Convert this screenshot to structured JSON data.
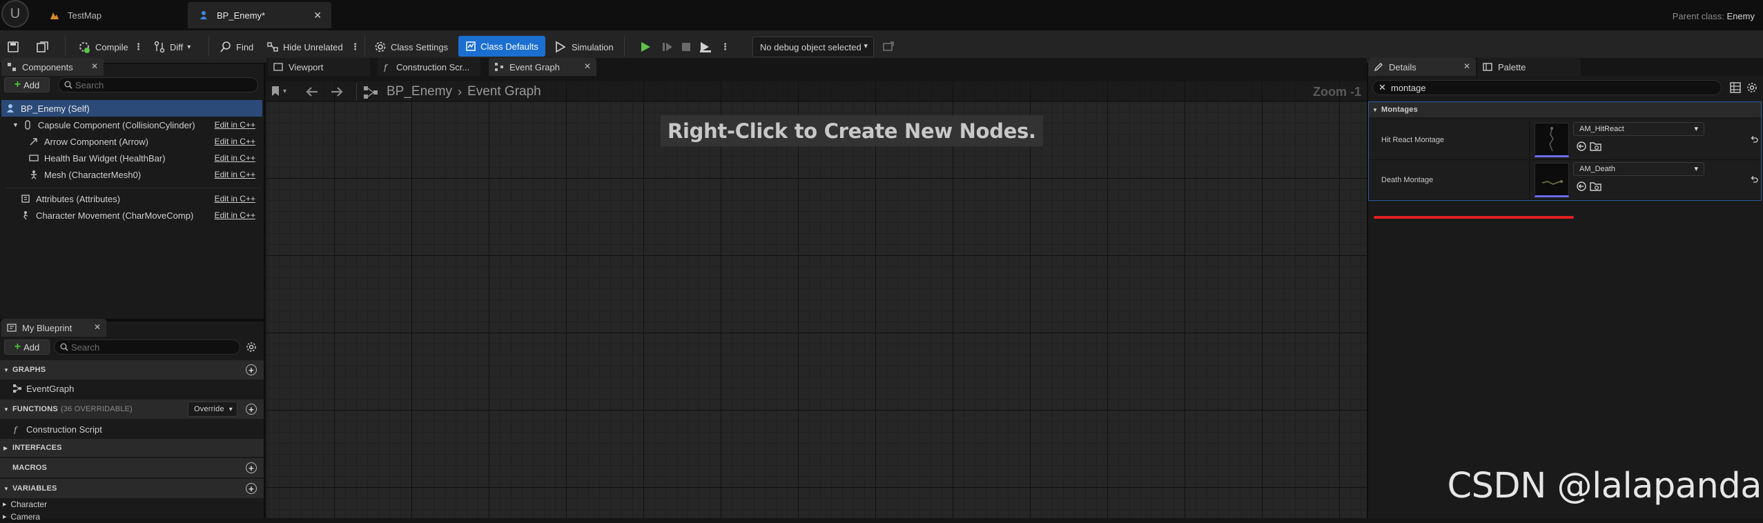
{
  "titlebar": {
    "tabs": [
      {
        "label": "TestMap",
        "icon": "map-icon"
      },
      {
        "label": "BP_Enemy*",
        "icon": "blueprint-pawn-icon"
      }
    ],
    "parent_class_label": "Parent class:",
    "parent_class_value": "Enemy"
  },
  "toolbar": {
    "compile": "Compile",
    "diff": "Diff",
    "find": "Find",
    "hide_unrelated": "Hide Unrelated",
    "class_settings": "Class Settings",
    "class_defaults": "Class Defaults",
    "simulation": "Simulation",
    "debug_object": "No debug object selected"
  },
  "components": {
    "tab": "Components",
    "add": "Add",
    "search_placeholder": "Search",
    "root": "BP_Enemy (Self)",
    "items": [
      {
        "label": "Capsule Component (CollisionCylinder)",
        "edit": "Edit in C++"
      },
      {
        "label": "Arrow Component (Arrow)",
        "edit": "Edit in C++"
      },
      {
        "label": "Health Bar Widget (HealthBar)",
        "edit": "Edit in C++"
      },
      {
        "label": "Mesh (CharacterMesh0)",
        "edit": "Edit in C++"
      },
      {
        "label": "Attributes (Attributes)",
        "edit": "Edit in C++"
      },
      {
        "label": "Character Movement (CharMoveComp)",
        "edit": "Edit in C++"
      }
    ]
  },
  "my_blueprint": {
    "tab": "My Blueprint",
    "add": "Add",
    "search_placeholder": "Search",
    "graphs_header": "GRAPHS",
    "event_graph": "EventGraph",
    "functions_header": "FUNCTIONS",
    "functions_count": "(36 OVERRIDABLE)",
    "override": "Override",
    "construction_script": "Construction Script",
    "interfaces_header": "INTERFACES",
    "macros_header": "MACROS",
    "variables_header": "VARIABLES",
    "var_categories": [
      "Character",
      "Camera"
    ]
  },
  "editor_tabs": {
    "viewport": "Viewport",
    "construction": "Construction Scr...",
    "event_graph": "Event Graph"
  },
  "graph": {
    "breadcrumb_root": "BP_Enemy",
    "breadcrumb_current": "Event Graph",
    "hint": "Right-Click to Create New Nodes.",
    "zoom": "Zoom -1"
  },
  "details": {
    "tab": "Details",
    "palette_tab": "Palette",
    "search_value": "montage",
    "section": "Montages",
    "rows": [
      {
        "label": "Hit React Montage",
        "asset": "AM_HitReact"
      },
      {
        "label": "Death Montage",
        "asset": "AM_Death"
      }
    ]
  },
  "watermark": "CSDN @lalapanda",
  "colors": {
    "accent_blue": "#1b6fd1",
    "play_green": "#5dc447",
    "annotation_red": "#e02020",
    "selection_blue": "#2b4a78"
  }
}
